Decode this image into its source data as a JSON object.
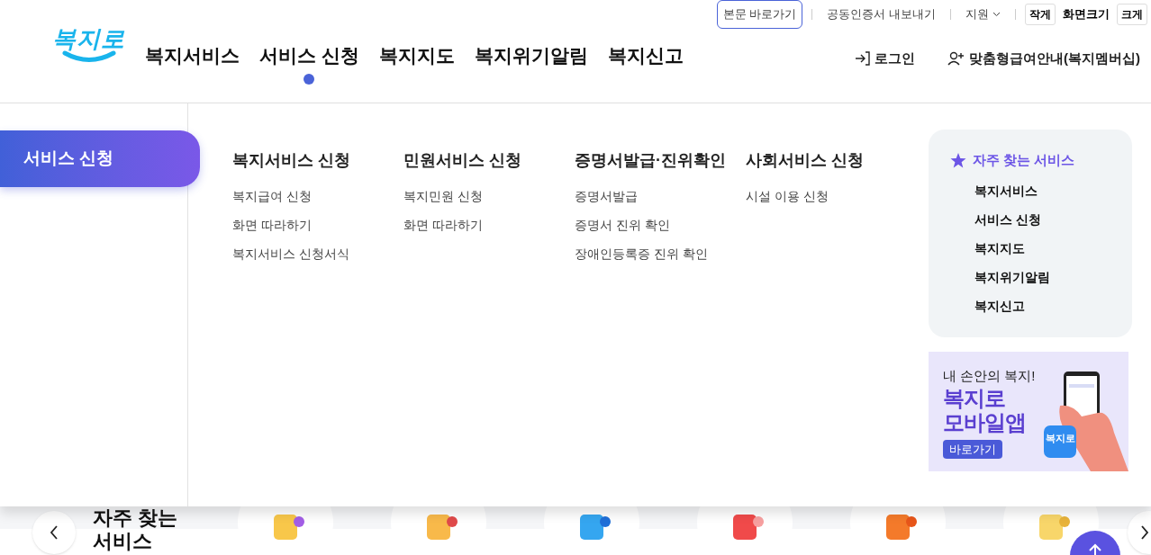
{
  "utility_bar": {
    "skip_link": "본문 바로가기",
    "links": [
      "공동인증서 내보내기"
    ],
    "support": "지원",
    "font_size": {
      "smaller": "작게",
      "label": "화면크기",
      "larger": "크게"
    }
  },
  "logo": "복지로",
  "nav": [
    {
      "label": "복지서비스",
      "selected": false
    },
    {
      "label": "서비스 신청",
      "selected": true
    },
    {
      "label": "복지지도",
      "selected": false
    },
    {
      "label": "복지위기알림",
      "selected": false
    },
    {
      "label": "복지신고",
      "selected": false
    }
  ],
  "account": [
    {
      "kind": "login",
      "label": "로그인"
    },
    {
      "kind": "membership",
      "label": "맞춤형급여안내(복지멤버십)"
    }
  ],
  "menu_panel": {
    "title": "서비스 신청",
    "columns": [
      {
        "heading": "복지서비스 신청",
        "items": [
          "복지급여 신청",
          "화면 따라하기",
          "복지서비스 신청서식"
        ]
      },
      {
        "heading": "민원서비스 신청",
        "items": [
          "복지민원 신청",
          "화면 따라하기"
        ]
      },
      {
        "heading": "증명서발급·진위확인",
        "items": [
          "증명서발급",
          "증명서 진위 확인",
          "장애인등록증 진위 확인"
        ]
      },
      {
        "heading": "사회서비스 신청",
        "items": [
          "시설 이용 신청"
        ]
      }
    ]
  },
  "favorites": {
    "title": "자주 찾는 서비스",
    "items": [
      "복지서비스",
      "서비스 신청",
      "복지지도",
      "복지위기알림",
      "복지신고"
    ]
  },
  "banner": {
    "tagline": "내 손안의 복지!",
    "title_lines": [
      "복지로",
      "모바일앱"
    ],
    "button": "바로가기",
    "app_icon_label": "복지로"
  },
  "quick_services": {
    "title": "자주 찾는 서비스"
  }
}
